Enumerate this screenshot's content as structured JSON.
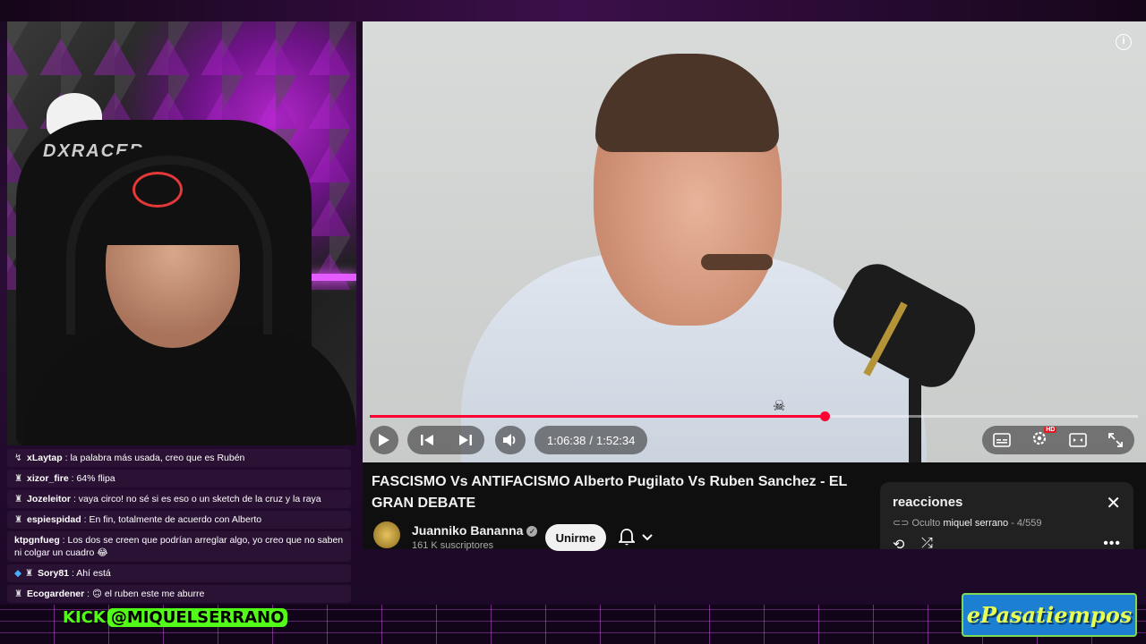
{
  "player": {
    "current_time": "1:06:38",
    "separator": "/",
    "duration": "1:52:34",
    "progress_fraction": 0.592,
    "accent_color": "#ff0033",
    "hd_badge": "HD"
  },
  "video": {
    "title": "FASCISMO Vs ANTIFACISMO Alberto Pugilato Vs Ruben Sanchez - EL GRAN DEBATE",
    "channel_name": "Juanniko Bananna",
    "subscribers": "161 K suscriptores",
    "join_label": "Unirme"
  },
  "playlist": {
    "title": "reacciones",
    "visibility": "Oculto",
    "owner": "miquel serrano",
    "position": "- 4/559"
  },
  "webcam": {
    "chair_brand": "DXRACER"
  },
  "chat": [
    {
      "user": "xLaytap",
      "text": ": la palabra más usada, creo que es Rubén",
      "badge": "↯",
      "badge2": ""
    },
    {
      "user": "xizor_fire",
      "text": ": 64% flipa",
      "badge": "♜",
      "badge2": ""
    },
    {
      "user": "Jozeleitor",
      "text": ": vaya circo! no sé si es eso o un sketch de la cruz y la raya",
      "badge": "♜",
      "badge2": ""
    },
    {
      "user": "espiespidad",
      "text": ": En fin, totalmente de acuerdo con Alberto",
      "badge": "♜",
      "badge2": ""
    },
    {
      "user": "ktpgnfueg",
      "text": ": Los dos se creen que podrían arreglar algo, yo creo que no saben ni colgar un cuadro 😂",
      "badge": "",
      "badge2": ""
    },
    {
      "user": "Sory81",
      "text": ": Ahí está",
      "badge": "♜",
      "badge2": "◆"
    },
    {
      "user": "Ecogardener",
      "text": ": 🙃 el ruben este me aburre",
      "badge": "♜",
      "badge2": ""
    }
  ],
  "branding": {
    "kick_prefix": "KICK",
    "kick_handle": "@MIQUELSERRANO",
    "logo_text": "ePasatiempos"
  },
  "icons": [
    "info-icon",
    "play-icon",
    "previous-icon",
    "next-icon",
    "volume-icon",
    "subtitles-icon",
    "settings-icon",
    "miniplayer-icon",
    "fullscreen-icon",
    "verified-icon",
    "bell-icon",
    "chevron-down-icon",
    "close-icon",
    "loop-icon",
    "shuffle-icon",
    "more-icon",
    "link-icon"
  ]
}
